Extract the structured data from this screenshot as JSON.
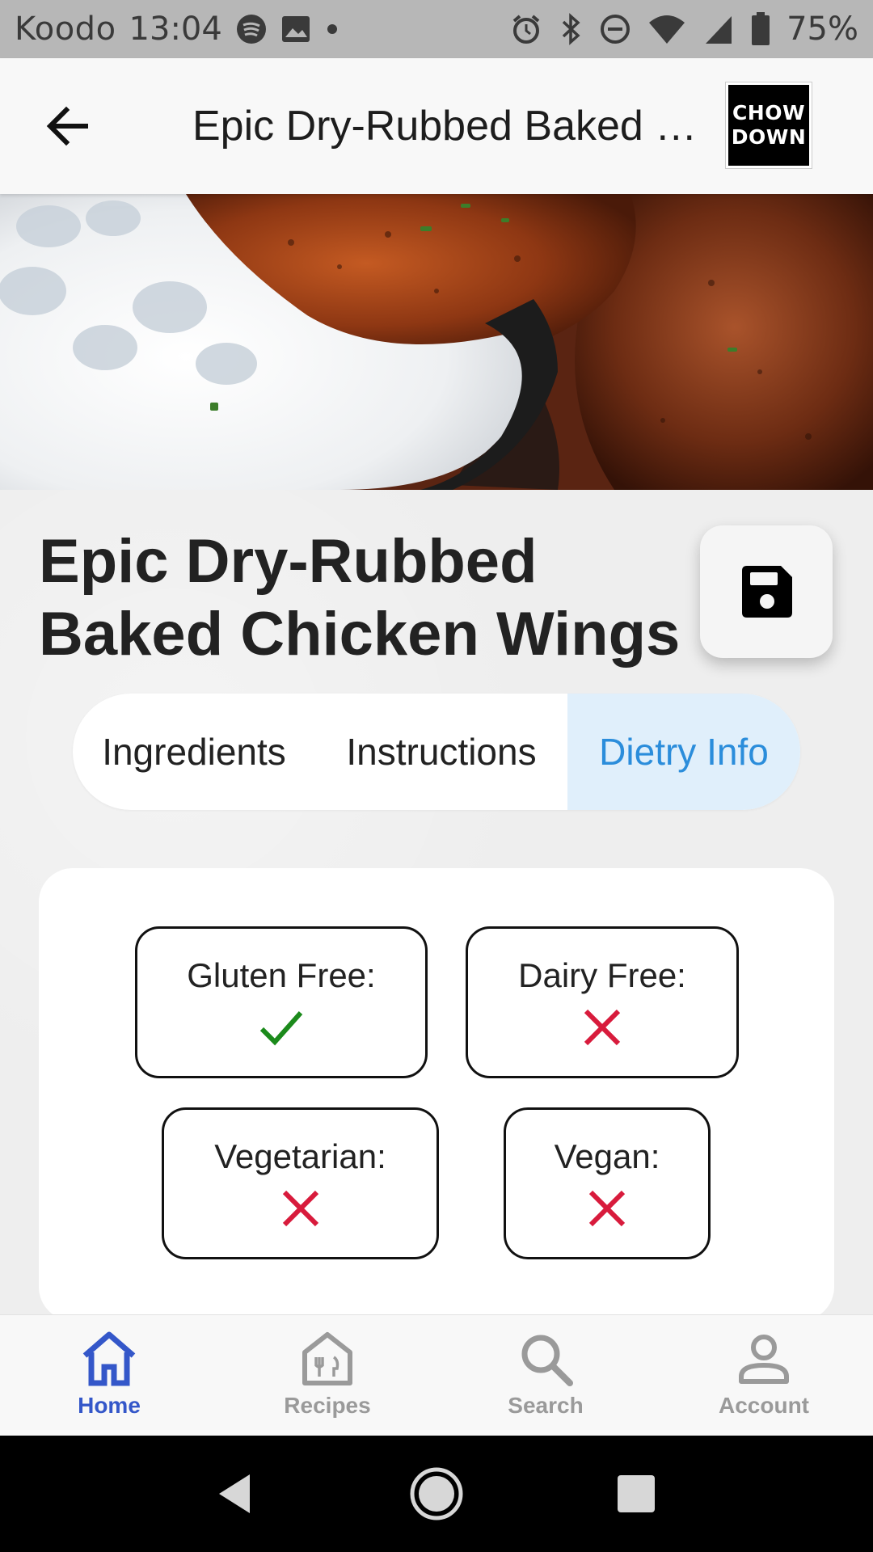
{
  "status_bar": {
    "carrier": "Koodo",
    "time": "13:04",
    "battery": "75%",
    "icons": [
      "spotify-icon",
      "image-icon",
      "dot-icon",
      "alarm-icon",
      "bluetooth-icon",
      "dnd-icon",
      "wifi-icon",
      "signal-icon",
      "battery-icon"
    ]
  },
  "app_bar": {
    "title": "Epic Dry-Rubbed Baked Chicken Wings",
    "back_icon": "arrow-left-icon",
    "logo_line1": "CHOW",
    "logo_line2": "DOWN"
  },
  "recipe": {
    "title": "Epic Dry-Rubbed Baked Chicken Wings",
    "save_icon": "floppy-disk-icon"
  },
  "tabs": [
    {
      "label": "Ingredients",
      "active": false
    },
    {
      "label": "Instructions",
      "active": false
    },
    {
      "label": "Dietry Info",
      "active": true
    }
  ],
  "diet": [
    {
      "label": "Gluten Free:",
      "value": true
    },
    {
      "label": "Dairy Free:",
      "value": false
    },
    {
      "label": "Vegetarian:",
      "value": false
    },
    {
      "label": "Vegan:",
      "value": false
    }
  ],
  "colors": {
    "check": "#1b8a1b",
    "cross": "#d81b3c",
    "accent": "#2b8ddb",
    "nav_active": "#3457c9",
    "nav_inactive": "#9a9a9a"
  },
  "bottom_nav": [
    {
      "label": "Home",
      "icon": "home-icon",
      "active": true
    },
    {
      "label": "Recipes",
      "icon": "recipes-icon",
      "active": false
    },
    {
      "label": "Search",
      "icon": "search-icon",
      "active": false
    },
    {
      "label": "Account",
      "icon": "account-icon",
      "active": false
    }
  ]
}
